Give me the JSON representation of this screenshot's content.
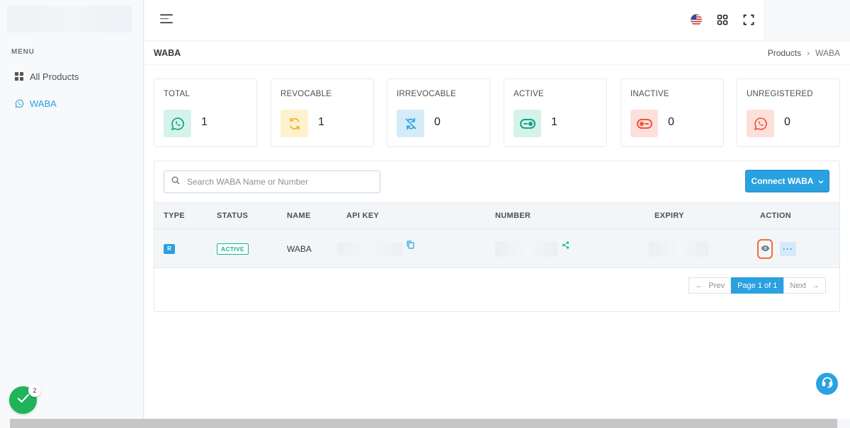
{
  "sidebar": {
    "menu_title": "MENU",
    "items": [
      {
        "label": "All Products",
        "icon": "grid-icon",
        "active": false
      },
      {
        "label": "WABA",
        "icon": "whatsapp-icon",
        "active": true
      }
    ]
  },
  "topbar": {
    "icons": [
      "hamburger-menu-icon",
      "us-flag-icon",
      "apps-grid-icon",
      "fullscreen-icon"
    ]
  },
  "page": {
    "title": "WABA",
    "breadcrumb": [
      "Products",
      "WABA"
    ]
  },
  "stats": [
    {
      "label": "TOTAL",
      "value": "1",
      "icon": "whatsapp-icon",
      "color": "#16b88a",
      "bg": "#d4f3ea"
    },
    {
      "label": "REVOCABLE",
      "value": "1",
      "icon": "refresh-icon",
      "color": "#f5b016",
      "bg": "#fdf1cf"
    },
    {
      "label": "IRREVOCABLE",
      "value": "0",
      "icon": "sync-off-icon",
      "color": "#2aa1e0",
      "bg": "#d5ebf8"
    },
    {
      "label": "ACTIVE",
      "value": "1",
      "icon": "toggle-on-icon",
      "color": "#16b88a",
      "bg": "#d4f3ea"
    },
    {
      "label": "INACTIVE",
      "value": "0",
      "icon": "toggle-off-icon",
      "color": "#f0533d",
      "bg": "#fde0db"
    },
    {
      "label": "UNREGISTERED",
      "value": "0",
      "icon": "whatsapp-icon",
      "color": "#f0533d",
      "bg": "#fde0db"
    }
  ],
  "search": {
    "placeholder": "Search WABA Name or Number"
  },
  "connect_button": {
    "label": "Connect WABA"
  },
  "table": {
    "columns": [
      "TYPE",
      "STATUS",
      "NAME",
      "API KEY",
      "NUMBER",
      "EXPIRY",
      "ACTION"
    ],
    "rows": [
      {
        "type": "R",
        "status": "ACTIVE",
        "name": "WABA"
      }
    ]
  },
  "pagination": {
    "prev": "Prev",
    "current": "Page 1 of 1",
    "next": "Next"
  },
  "notifications": {
    "count": "2"
  }
}
